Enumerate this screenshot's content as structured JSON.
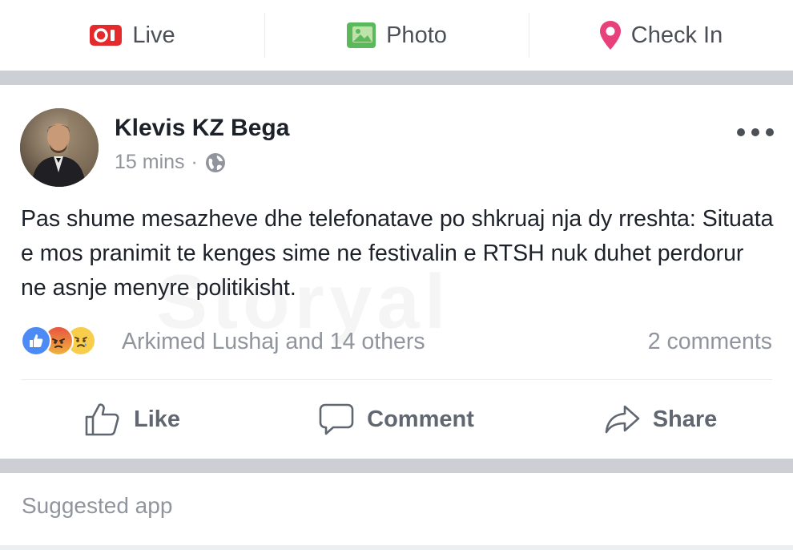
{
  "composer": {
    "live_label": "Live",
    "photo_label": "Photo",
    "checkin_label": "Check In"
  },
  "post": {
    "author": "Klevis KZ Bega",
    "time": "15 mins",
    "meta_separator": "·",
    "text": "Pas shume mesazheve dhe telefonatave po shkruaj nja dy rreshta: Situata e mos pranimit te kenges sime ne festivalin e RTSH nuk duhet perdorur ne asnje menyre politikisht.",
    "watermark": "Storyal",
    "reactions_summary": "Arkimed Lushaj and 14 others",
    "reactions": [
      "like",
      "angry",
      "sad"
    ],
    "comments_count": "2 comments"
  },
  "actions": {
    "like_label": "Like",
    "comment_label": "Comment",
    "share_label": "Share"
  },
  "suggested": {
    "label": "Suggested app"
  },
  "colors": {
    "live_red": "#e42a2a",
    "photo_green": "#5cb85c",
    "checkin_pink": "#e8407a",
    "like_blue": "#4c8bf5",
    "muted_text": "#90949c",
    "separator": "#cccfd4"
  }
}
